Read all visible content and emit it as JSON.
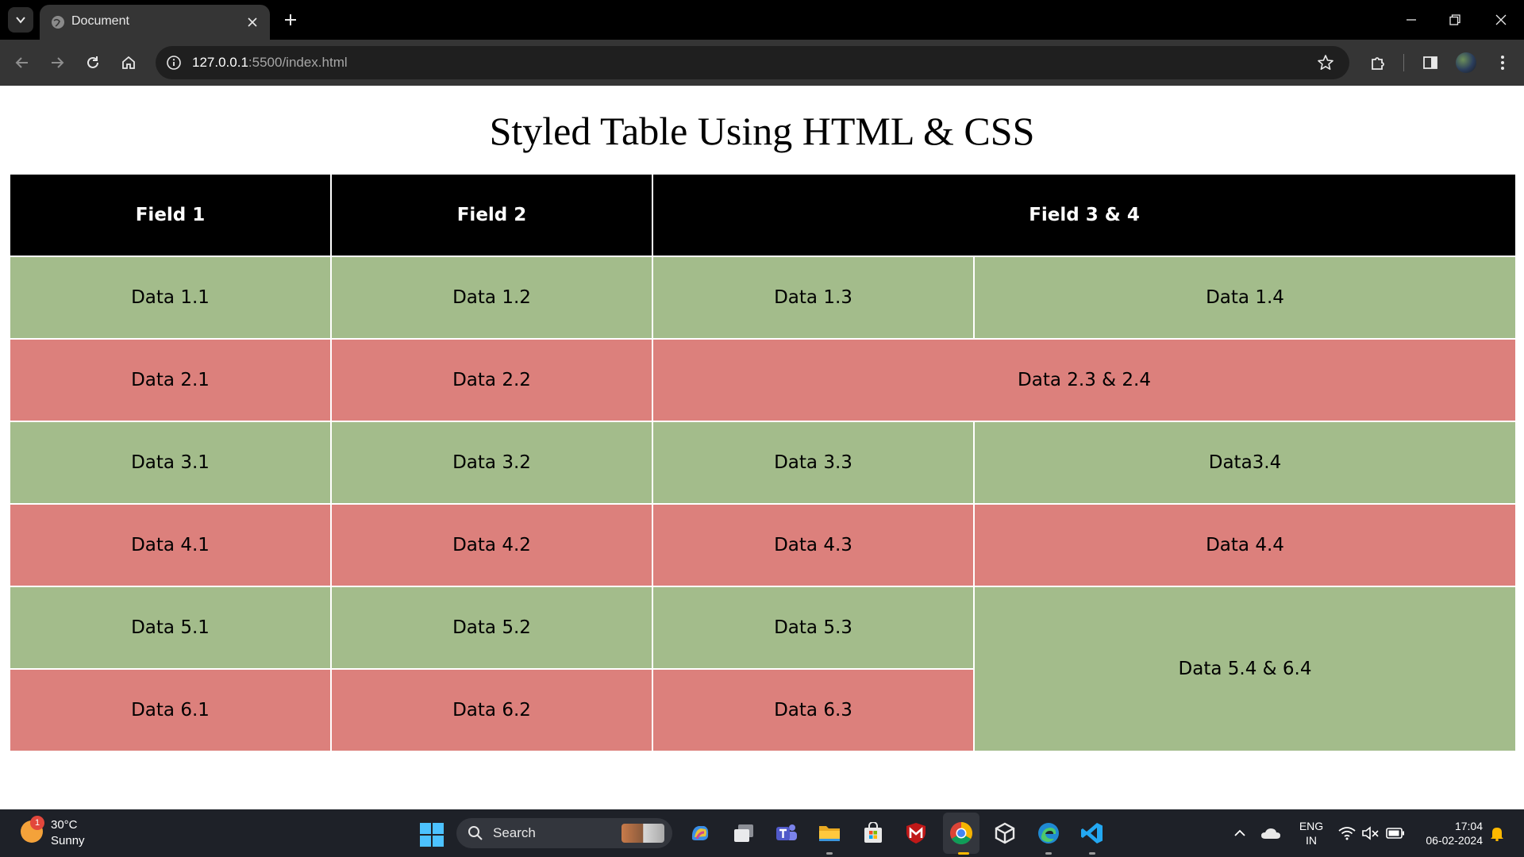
{
  "browser": {
    "tab_title": "Document",
    "url_host": "127.0.0.1",
    "url_path": ":5500/index.html"
  },
  "page": {
    "title": "Styled Table Using HTML & CSS",
    "headers": [
      "Field 1",
      "Field 2",
      "Field 3 & 4"
    ],
    "rows": [
      [
        "Data 1.1",
        "Data 1.2",
        "Data 1.3",
        "Data 1.4"
      ],
      [
        "Data 2.1",
        "Data 2.2",
        "Data 2.3 & 2.4"
      ],
      [
        "Data 3.1",
        "Data 3.2",
        "Data 3.3",
        "Data3.4"
      ],
      [
        "Data 4.1",
        "Data 4.2",
        "Data 4.3",
        "Data 4.4"
      ],
      [
        "Data 5.1",
        "Data 5.2",
        "Data 5.3",
        "Data 5.4 & 6.4"
      ],
      [
        "Data 6.1",
        "Data 6.2",
        "Data 6.3"
      ]
    ],
    "colors": {
      "header": "#000000",
      "green": "#a3bc8b",
      "red": "#dc807c"
    }
  },
  "taskbar": {
    "weather_temp": "30°C",
    "weather_cond": "Sunny",
    "weather_badge": "1",
    "search_label": "Search",
    "lang_line1": "ENG",
    "lang_line2": "IN",
    "time": "17:04",
    "date": "06-02-2024",
    "apps": [
      "copilot-icon",
      "task-view-icon",
      "teams-icon",
      "file-explorer-icon",
      "microsoft-store-icon",
      "mcafee-icon",
      "chrome-icon",
      "unity-icon",
      "edge-icon",
      "vscode-icon"
    ]
  }
}
